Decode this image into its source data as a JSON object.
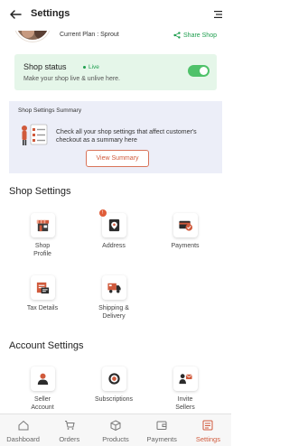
{
  "header": {
    "title": "Settings"
  },
  "shop": {
    "plan_text": "Current Plan : Sprout",
    "share_label": "Share Shop"
  },
  "status": {
    "title": "Shop status",
    "live_label": "Live",
    "subtitle": "Make your shop live & unlive here.",
    "enabled": true
  },
  "summary": {
    "title": "Shop Settings Summary",
    "description": "Check all your shop settings that affect customer's checkout as a summary here",
    "button_label": "View Summary"
  },
  "shop_settings": {
    "title": "Shop Settings",
    "items": [
      {
        "label": "Shop Profile",
        "icon": "shop-profile-icon"
      },
      {
        "label": "Address",
        "icon": "address-icon",
        "badge": "!"
      },
      {
        "label": "Payments",
        "icon": "payments-icon"
      },
      {
        "label": "Tax Details",
        "icon": "tax-details-icon"
      },
      {
        "label": "Shipping & Delivery",
        "icon": "shipping-icon"
      }
    ]
  },
  "account_settings": {
    "title": "Account Settings",
    "items": [
      {
        "label": "Seller Account",
        "icon": "seller-account-icon"
      },
      {
        "label": "Subscriptions",
        "icon": "subscriptions-icon"
      },
      {
        "label": "Invite Sellers",
        "icon": "invite-sellers-icon"
      }
    ]
  },
  "bottom_nav": [
    {
      "label": "Dashboard",
      "icon": "dashboard-icon"
    },
    {
      "label": "Orders",
      "icon": "cart-icon"
    },
    {
      "label": "Products",
      "icon": "box-icon"
    },
    {
      "label": "Payments",
      "icon": "wallet-icon"
    },
    {
      "label": "Settings",
      "icon": "settings-icon",
      "active": true
    }
  ],
  "colors": {
    "accent": "#d05a3c",
    "live_green": "#1e9e4e",
    "status_bg": "#e5f6e9",
    "summary_bg": "#eceef8"
  }
}
